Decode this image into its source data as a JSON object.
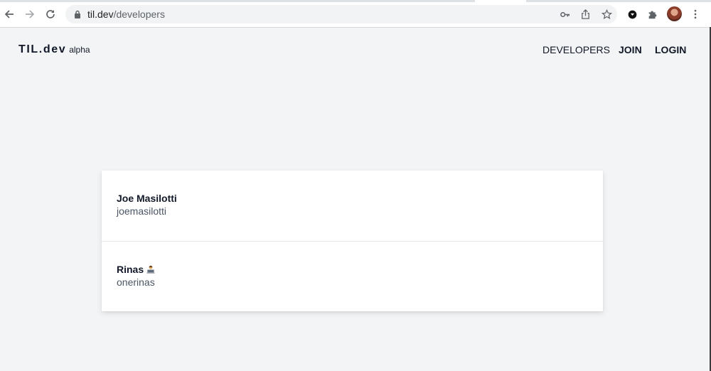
{
  "browser": {
    "url_host": "til.dev",
    "url_path": "/developers"
  },
  "header": {
    "logo": "TIL.dev",
    "tag": "alpha",
    "nav": {
      "developers": "DEVELOPERS",
      "join": "JOIN",
      "login": "LOGIN"
    }
  },
  "developers": [
    {
      "name": "Joe Masilotti",
      "handle": "joemasilotti"
    },
    {
      "name": "Rinas",
      "handle": "onerinas",
      "icon": "technologist-emoji-icon"
    }
  ]
}
